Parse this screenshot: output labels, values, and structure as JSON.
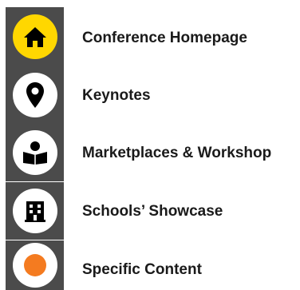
{
  "legend": {
    "items": [
      {
        "label": "Conference Homepage",
        "icon": "home-icon",
        "circle_color": "#ffd700"
      },
      {
        "label": "Keynotes",
        "icon": "map-pin-icon",
        "circle_color": "#ffffff"
      },
      {
        "label": "Marketplaces & Workshop",
        "icon": "reader-book-icon",
        "circle_color": "#ffffff"
      },
      {
        "label": "Schools’ Showcase",
        "icon": "building-icon",
        "circle_color": "#ffffff"
      },
      {
        "label": "Specific Content",
        "icon": "orange-dot-icon",
        "circle_color": "#ffffff"
      }
    ]
  },
  "colors": {
    "tile": "#4b4b4b",
    "home_accent": "#ffd700",
    "orange_dot": "#f47b20",
    "icon_black": "#000000"
  }
}
